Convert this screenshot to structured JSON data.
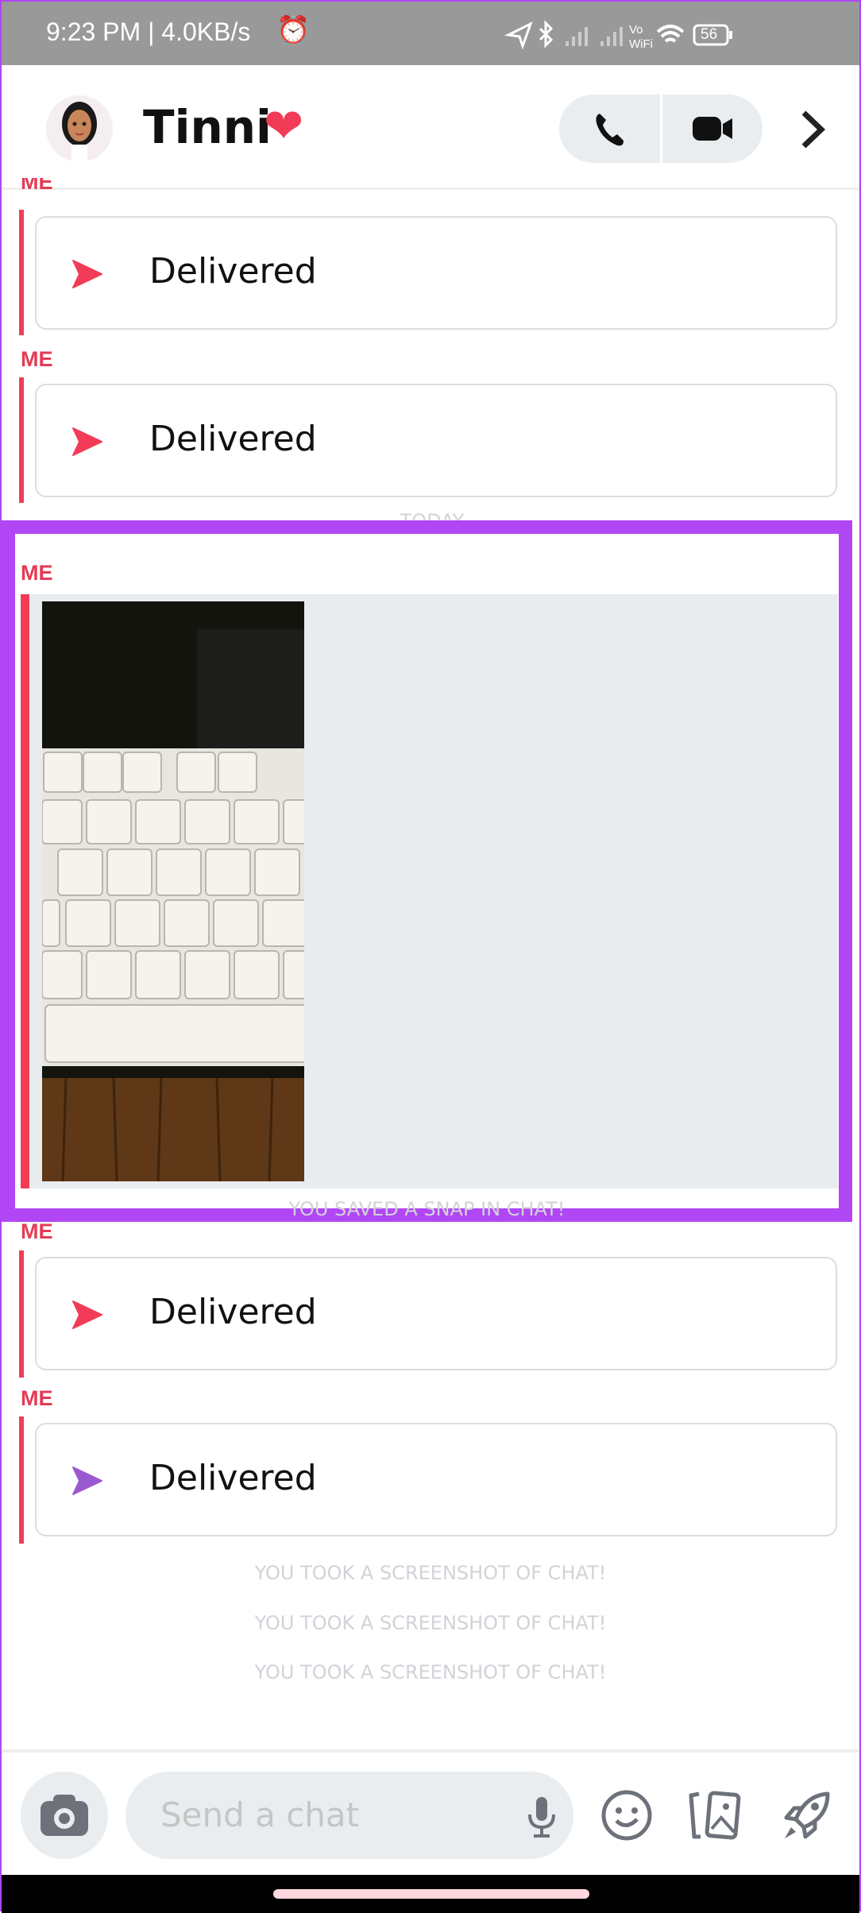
{
  "status_bar": {
    "time_speed": "9:23 PM | 4.0KB/s",
    "battery": "56",
    "vowifi": "Vo\nWiFi"
  },
  "header": {
    "contact_name": "Tinni",
    "emoji": "❤",
    "icons": [
      "phone-icon",
      "video-camera-icon",
      "chevron-right-icon"
    ]
  },
  "messages": [
    {
      "sender": "ME",
      "status": "Delivered",
      "arrow_color": "#f23c57"
    },
    {
      "sender": "ME",
      "status": "Delivered",
      "arrow_color": "#f23c57"
    },
    {
      "date_separator": "TODAY"
    },
    {
      "sender": "ME",
      "type": "snap-image",
      "note": "YOU SAVED A SNAP IN CHAT!"
    },
    {
      "sender": "ME",
      "status": "Delivered",
      "arrow_color": "#f23c57"
    },
    {
      "sender": "ME",
      "status": "Delivered",
      "arrow_color": "#9b59d0"
    }
  ],
  "system_notes": [
    "YOU TOOK A SCREENSHOT OF CHAT!",
    "YOU TOOK A SCREENSHOT OF CHAT!",
    "YOU TOOK A SCREENSHOT OF CHAT!"
  ],
  "composer": {
    "placeholder": "Send a chat",
    "icons": [
      "camera-icon",
      "microphone-icon",
      "emoji-icon",
      "stickers-icon",
      "rocket-icon"
    ]
  },
  "colors": {
    "accent": "#f23c57",
    "highlight": "#b146f5",
    "snap_bg": "#e8ecef"
  }
}
